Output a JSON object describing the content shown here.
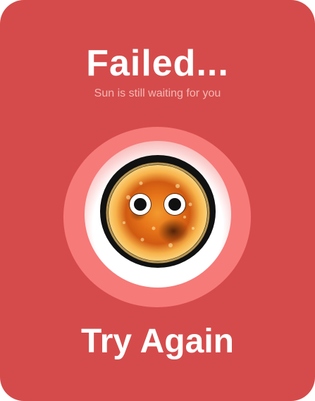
{
  "card": {
    "title": "Failed...",
    "subtitle": "Sun is still waiting for you",
    "action_label": "Try Again"
  },
  "colors": {
    "background": "#d54b4b",
    "halo_outer": "#f67a78",
    "subtitle": "#f3b8b4",
    "text": "#ffffff"
  },
  "icons": {
    "mascot": "sun-face-icon"
  }
}
